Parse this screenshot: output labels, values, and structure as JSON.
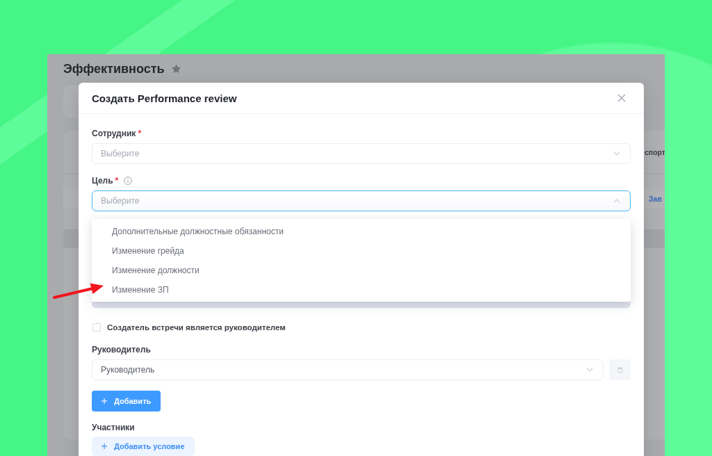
{
  "page": {
    "title": "Эффективность",
    "toolbar_text": "спорт",
    "row_link": "Зав"
  },
  "modal": {
    "title": "Создать Performance review",
    "form": [
      {
        "kind": "select",
        "label": "Сотрудник",
        "required_mark": "*",
        "placeholder": "Выберите",
        "expanded": false
      },
      {
        "kind": "select",
        "label": "Цель",
        "required_mark": "*",
        "info": true,
        "placeholder": "Выберите",
        "expanded": true,
        "options": [
          {
            "label": "Дополнительные должностные обязанности",
            "selected": false
          },
          {
            "label": "Изменение грейда",
            "selected": false
          },
          {
            "label": "Изменение должности",
            "selected": false
          },
          {
            "label": "Изменение ЗП",
            "selected": false
          }
        ]
      },
      {
        "kind": "checkbox",
        "label": "Создатель встречи является руководителем",
        "checked": false
      },
      {
        "kind": "select",
        "label": "Руководитель",
        "value": "Руководитель",
        "expanded": false,
        "removable": true
      },
      {
        "kind": "primary_button",
        "label": "Добавить"
      },
      {
        "kind": "heading",
        "label": "Участники"
      },
      {
        "kind": "secondary_button",
        "label": "Добавить условие"
      }
    ]
  },
  "annotation_arrow": true
}
